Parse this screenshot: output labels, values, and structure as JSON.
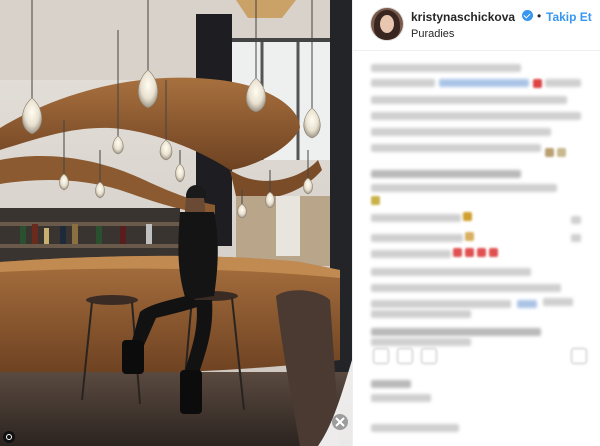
{
  "post": {
    "username": "kristynaschickova",
    "follow_label": "Takip Et",
    "separator": "•",
    "location": "Puradies",
    "verified": true
  },
  "icons": {
    "verified": "verified-badge-icon",
    "avatar": "profile-avatar",
    "brand": "site-watermark-logo"
  },
  "colors": {
    "link": "#3897f0",
    "text": "#262626",
    "border": "#efefef"
  }
}
